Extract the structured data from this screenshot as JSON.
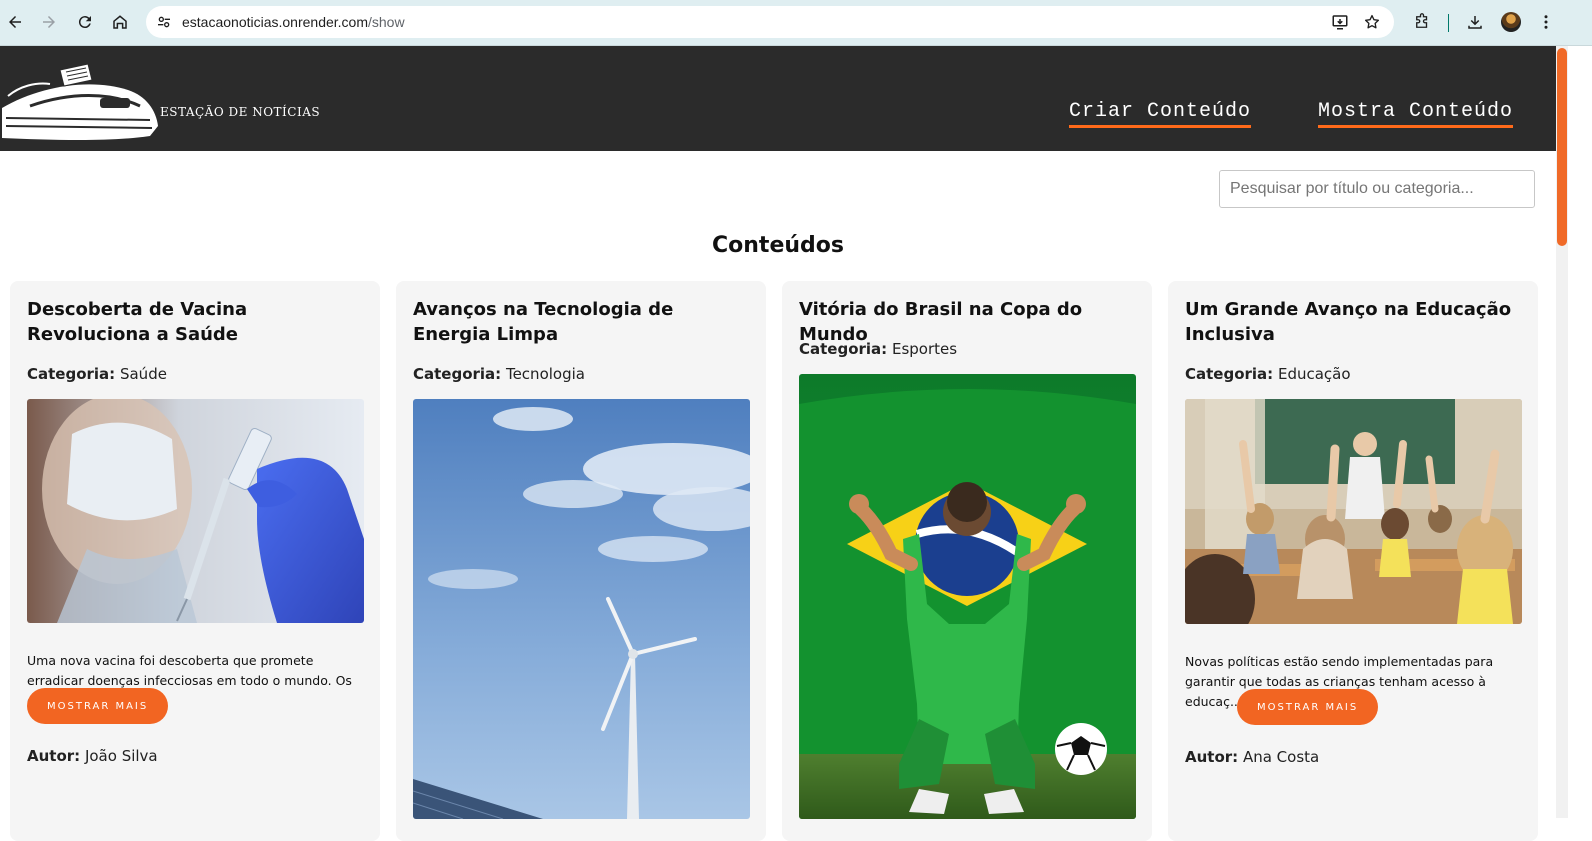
{
  "browser": {
    "url_host": "estacaonoticias.onrender.com",
    "url_path": "/show"
  },
  "header": {
    "logo_text": "ESTAÇÃO DE NOTÍCIAS",
    "nav": [
      {
        "label": "Criar Conteúdo"
      },
      {
        "label": "Mostra Conteúdo"
      }
    ]
  },
  "search": {
    "placeholder": "Pesquisar por título ou categoria...",
    "value": ""
  },
  "main": {
    "title": "Conteúdos",
    "category_prefix": "Categoria:",
    "author_prefix": "Autor:",
    "more_label": "MOSTRAR MAIS",
    "cards": [
      {
        "title": "Descoberta de Vacina Revoluciona a Saúde",
        "category": "Saúde",
        "description": "Uma nova vacina foi descoberta que promete erradicar doenças infecciosas em todo o mundo. Os cientis...",
        "author": "João Silva"
      },
      {
        "title": "Avanços na Tecnologia de Energia Limpa",
        "category": "Tecnologia"
      },
      {
        "title": "Vitória do Brasil na Copa do Mundo",
        "category": "Esportes"
      },
      {
        "title": "Um Grande Avanço na Educação Inclusiva",
        "category": "Educação",
        "description": "Novas políticas estão sendo implementadas para garantir que todas as crianças tenham acesso à educaç...",
        "author": "Ana Costa"
      }
    ]
  },
  "colors": {
    "header_bg": "#2b2b2b",
    "accent": "#f26522",
    "card_bg": "#f5f5f5",
    "chrome_bg": "#dfeef1"
  }
}
